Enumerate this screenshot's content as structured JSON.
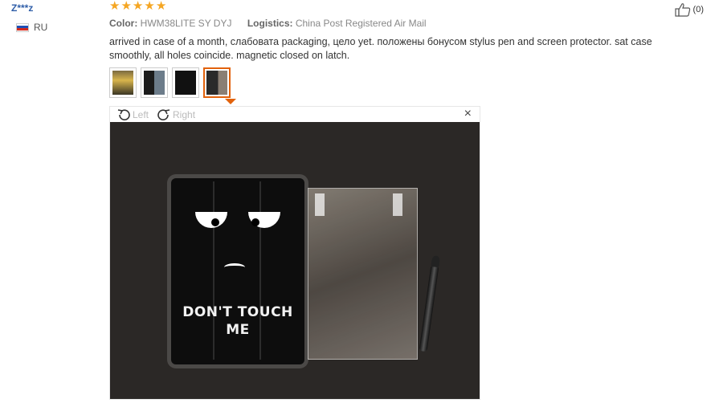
{
  "reviewer": {
    "name": "Z***z",
    "country_code": "RU",
    "flag_colors": [
      "#ffffff",
      "#1f4fb5",
      "#d52b1e"
    ]
  },
  "rating": {
    "stars": 5,
    "max": 5,
    "star_color": "#f5a623"
  },
  "meta": {
    "color_label": "Color:",
    "color_value": "HWM38LITE SY DYJ",
    "logistics_label": "Logistics:",
    "logistics_value": "China Post Registered Air Mail"
  },
  "helpful": {
    "count_text": "(0)",
    "icon": "thumbs-up-icon"
  },
  "review_text": "arrived in case of a month, слабовата packaging, цело yet. положены бонусом stylus pen and screen protector. sat case smoothly, all holes coincide. magnetic closed on latch.",
  "thumbnails": [
    {
      "id": "photo-1",
      "active": false
    },
    {
      "id": "photo-2",
      "active": false
    },
    {
      "id": "photo-3",
      "active": false
    },
    {
      "id": "photo-4",
      "active": true
    }
  ],
  "viewer": {
    "rotate_left_label": "Left",
    "rotate_right_label": "Right",
    "close_glyph": "×",
    "case_text_line1": "DON'T TOUCH",
    "case_text_line2": "ME",
    "accent_color": "#e2620c"
  }
}
